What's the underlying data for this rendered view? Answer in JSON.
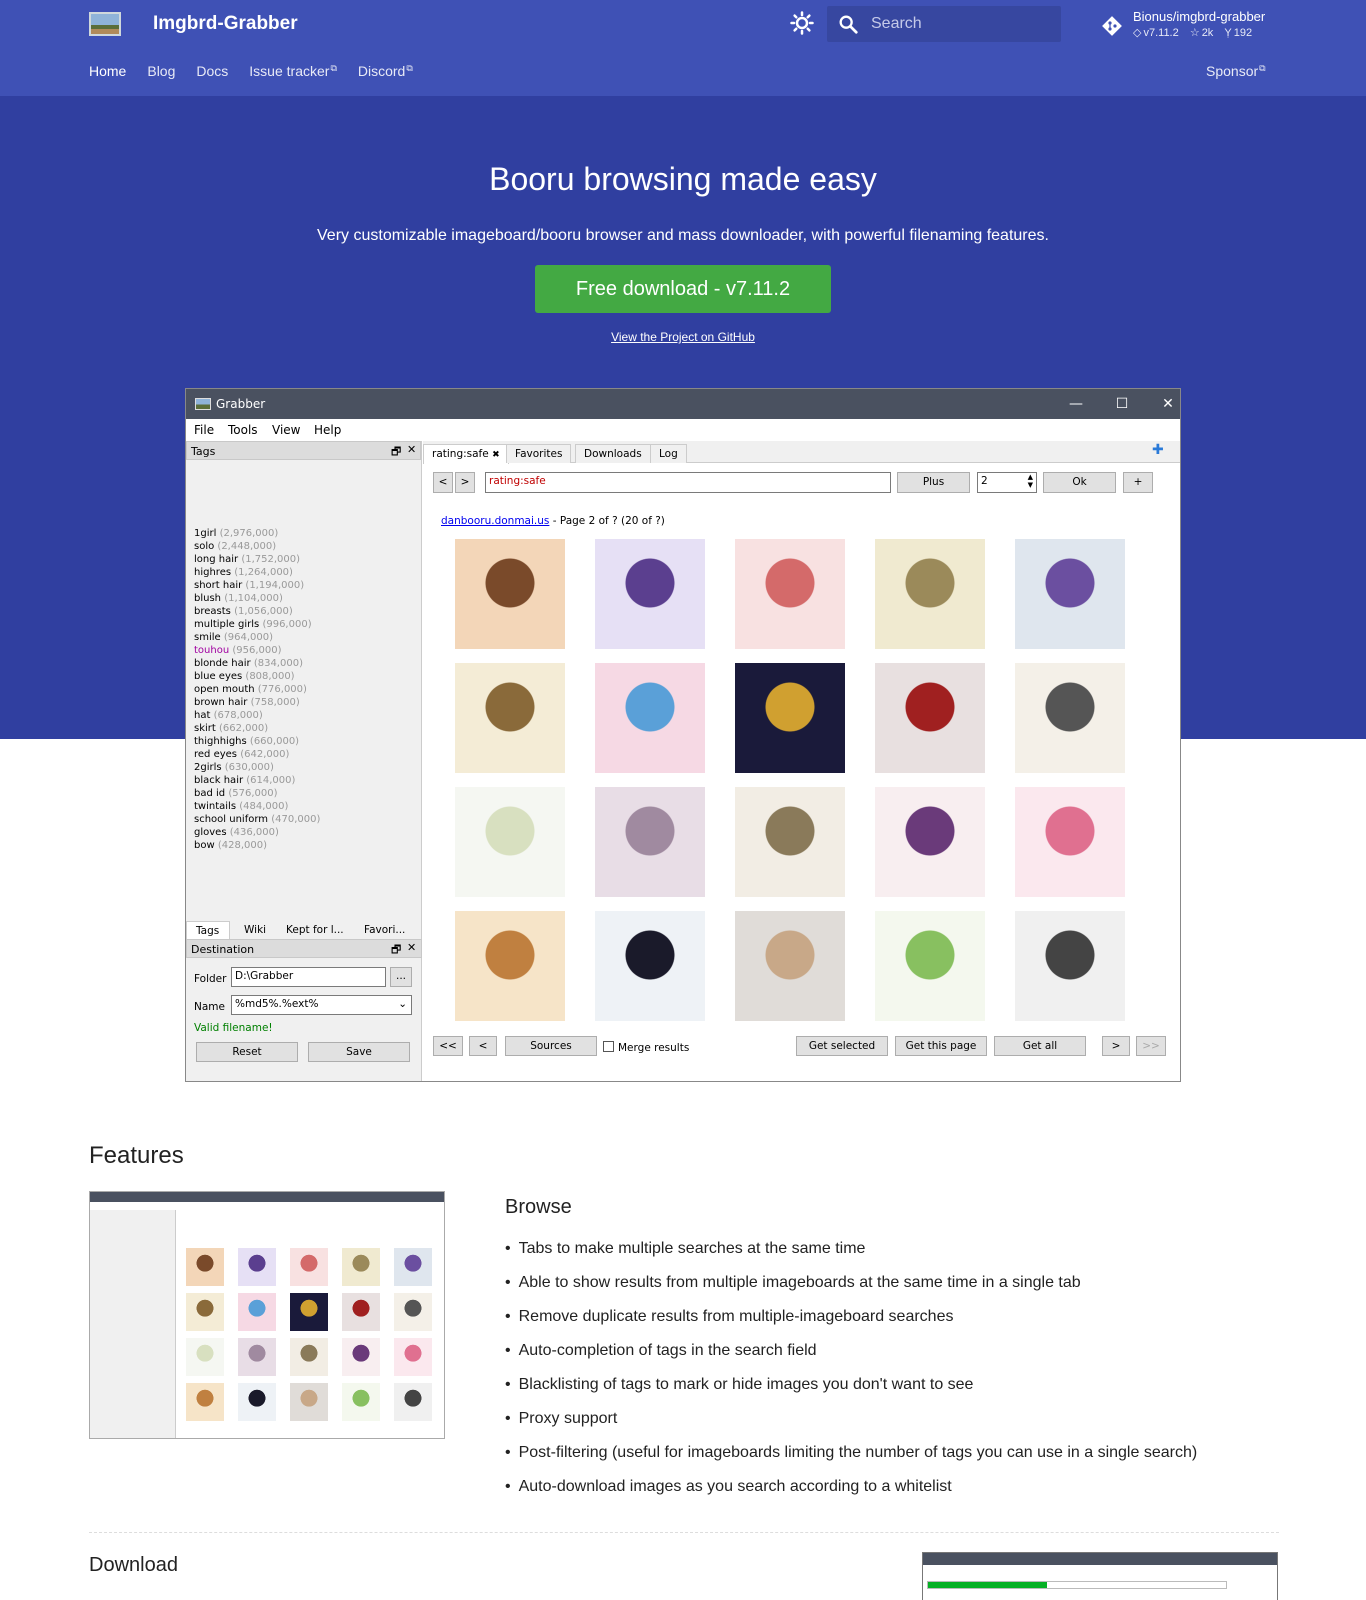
{
  "header": {
    "site_title": "Imgbrd-Grabber",
    "search_placeholder": "Search",
    "repo": {
      "name": "Bionus/imgbrd-grabber",
      "version": "v7.11.2",
      "stars": "2k",
      "forks": "192"
    },
    "nav": [
      "Home",
      "Blog",
      "Docs",
      "Issue tracker",
      "Discord"
    ],
    "sponsor": "Sponsor"
  },
  "hero": {
    "title": "Booru browsing made easy",
    "tagline": "Very customizable imageboard/booru browser and mass downloader, with powerful filenaming features.",
    "download_button": "Free download - v7.11.2",
    "github_link": "View the Project on GitHub"
  },
  "app": {
    "window_title": "Grabber",
    "menu": [
      "File",
      "Tools",
      "View",
      "Help"
    ],
    "tags_dock_title": "Tags",
    "tags": [
      {
        "name": "1girl",
        "count": "(2,976,000)"
      },
      {
        "name": "solo",
        "count": "(2,448,000)"
      },
      {
        "name": "long hair",
        "count": "(1,752,000)"
      },
      {
        "name": "highres",
        "count": "(1,264,000)"
      },
      {
        "name": "short hair",
        "count": "(1,194,000)"
      },
      {
        "name": "blush",
        "count": "(1,104,000)"
      },
      {
        "name": "breasts",
        "count": "(1,056,000)"
      },
      {
        "name": "multiple girls",
        "count": "(996,000)"
      },
      {
        "name": "smile",
        "count": "(964,000)"
      },
      {
        "name": "touhou",
        "count": "(956,000)"
      },
      {
        "name": "blonde hair",
        "count": "(834,000)"
      },
      {
        "name": "blue eyes",
        "count": "(808,000)"
      },
      {
        "name": "open mouth",
        "count": "(776,000)"
      },
      {
        "name": "brown hair",
        "count": "(758,000)"
      },
      {
        "name": "hat",
        "count": "(678,000)"
      },
      {
        "name": "skirt",
        "count": "(662,000)"
      },
      {
        "name": "thighhighs",
        "count": "(660,000)"
      },
      {
        "name": "red eyes",
        "count": "(642,000)"
      },
      {
        "name": "2girls",
        "count": "(630,000)"
      },
      {
        "name": "black hair",
        "count": "(614,000)"
      },
      {
        "name": "bad id",
        "count": "(576,000)"
      },
      {
        "name": "twintails",
        "count": "(484,000)"
      },
      {
        "name": "school uniform",
        "count": "(470,000)"
      },
      {
        "name": "gloves",
        "count": "(436,000)"
      },
      {
        "name": "bow",
        "count": "(428,000)"
      }
    ],
    "left_tabs": [
      "Tags",
      "Wiki",
      "Kept for l...",
      "Favori..."
    ],
    "destination_title": "Destination",
    "folder_label": "Folder",
    "folder_value": "D:\\Grabber",
    "browse_button": "...",
    "name_label": "Name",
    "name_value": "%md5%.%ext%",
    "valid_text": "Valid filename!",
    "reset_button": "Reset",
    "save_button": "Save",
    "tabs": [
      "rating:safe",
      "Favorites",
      "Downloads",
      "Log"
    ],
    "tab_close": "✖",
    "search_value": "rating:safe",
    "plus_button": "Plus",
    "page_value": "2",
    "ok_button": "Ok",
    "add_button": "+",
    "prev_button": "<",
    "next_button": ">",
    "source_site": "danbooru.donmai.us",
    "source_info": " - Page 2 of ? (20 of ?)",
    "bottom": {
      "first": "<<",
      "prev": "<",
      "sources": "Sources",
      "merge": "Merge results",
      "get_selected": "Get selected",
      "get_page": "Get this page",
      "get_all": "Get all",
      "next": ">",
      "last": ">>"
    }
  },
  "features": {
    "title": "Features",
    "browse_title": "Browse",
    "items": [
      "Tabs to make multiple searches at the same time",
      "Able to show results from multiple imageboards at the same time in a single tab",
      "Remove duplicate results from multiple-imageboard searches",
      "Auto-completion of tags in the search field",
      "Blacklisting of tags to mark or hide images you don't want to see",
      "Proxy support",
      "Post-filtering (useful for imageboards limiting the number of tags you can use in a single search)",
      "Auto-download images as you search according to a whitelist"
    ],
    "download_title": "Download"
  }
}
